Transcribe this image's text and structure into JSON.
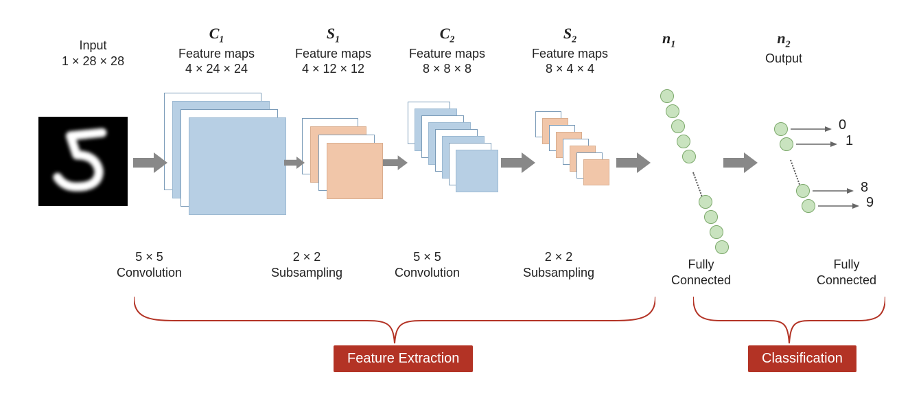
{
  "input": {
    "title": "Input",
    "dims": "1 × 28 × 28"
  },
  "c1": {
    "name": "C",
    "sub": "1",
    "desc": "Feature maps",
    "dims": "4 × 24 × 24"
  },
  "s1": {
    "name": "S",
    "sub": "1",
    "desc": "Feature maps",
    "dims": "4 × 12 × 12"
  },
  "c2": {
    "name": "C",
    "sub": "2",
    "desc": "Feature maps",
    "dims": "8 × 8 × 8"
  },
  "s2": {
    "name": "S",
    "sub": "2",
    "desc": "Feature maps",
    "dims": "8 × 4 × 4"
  },
  "n1": {
    "name": "n",
    "sub": "1"
  },
  "n2": {
    "name": "n",
    "sub": "2",
    "desc": "Output"
  },
  "ops": {
    "conv55a": {
      "l1": "5 × 5",
      "l2": "Convolution"
    },
    "sub22a": {
      "l1": "2 × 2",
      "l2": "Subsampling"
    },
    "conv55b": {
      "l1": "5 × 5",
      "l2": "Convolution"
    },
    "sub22b": {
      "l1": "2 × 2",
      "l2": "Subsampling"
    },
    "fc1": {
      "l1": "Fully",
      "l2": "Connected"
    },
    "fc2": {
      "l1": "Fully",
      "l2": "Connected"
    }
  },
  "outputs": {
    "top1": "0",
    "top2": "1",
    "bot1": "8",
    "bot2": "9"
  },
  "sections": {
    "feat": "Feature Extraction",
    "cls": "Classification"
  }
}
